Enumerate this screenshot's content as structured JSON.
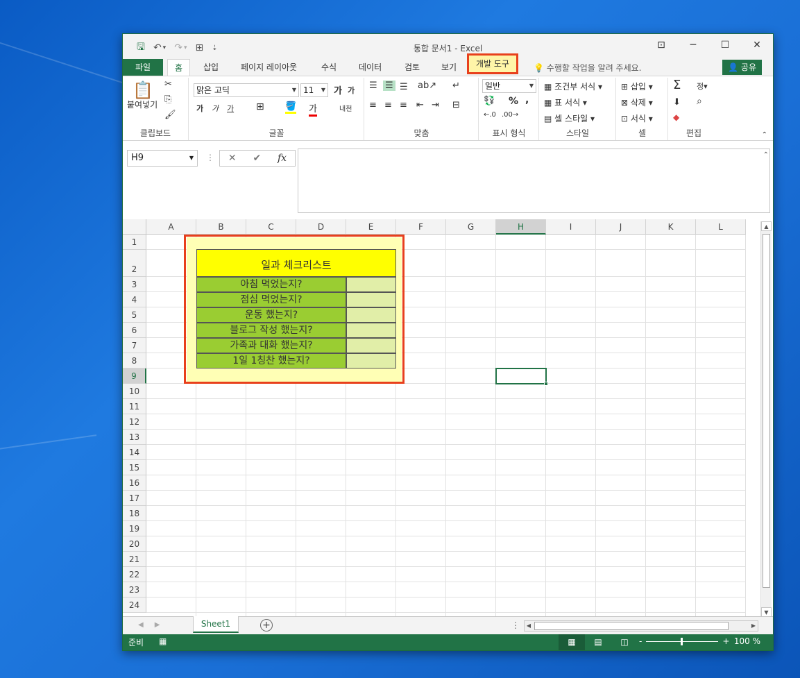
{
  "window": {
    "title": "통합 문서1 - Excel",
    "controls": {
      "ribbon_display": "⊡",
      "minimize": "─",
      "maximize": "☐",
      "close": "✕"
    }
  },
  "qat": {
    "save": "🖫",
    "undo": "↶",
    "undo_drop": "▾",
    "redo": "↷",
    "redo_drop": "▾",
    "touch": "⊞",
    "customize": "⇣"
  },
  "tabs": {
    "file": "파일",
    "home": "홈",
    "insert": "삽입",
    "page_layout": "페이지 레이아웃",
    "formulas": "수식",
    "data": "데이터",
    "review": "검토",
    "view": "보기",
    "developer": "개발 도구",
    "tell_me": "수행할 작업을 알려 주세요.",
    "share": "공유"
  },
  "ribbon": {
    "clipboard": {
      "label": "클립보드",
      "paste": "붙여넣기",
      "cut": "✂",
      "copy": "⎘",
      "format_painter": "🖌"
    },
    "font": {
      "label": "글꼴",
      "font_name": "맑은 고딕",
      "font_size": "11",
      "grow": "가",
      "shrink": "가",
      "bold": "가",
      "italic": "가",
      "underline": "가",
      "border": "⊞",
      "fill": "🪣",
      "font_color": "가",
      "phonetic": "내천"
    },
    "alignment": {
      "label": "맞춤"
    },
    "number": {
      "label": "표시 형식",
      "format": "일반",
      "percent": "%",
      "comma": ","
    },
    "styles": {
      "label": "스타일",
      "conditional": "조건부 서식",
      "table": "표 서식",
      "cell_styles": "셀 스타일"
    },
    "cells": {
      "label": "셀",
      "insert": "삽입",
      "delete": "삭제",
      "format": "서식"
    },
    "editing": {
      "label": "편집",
      "sum": "Σ",
      "sort": "정▾",
      "find": "⌕",
      "fill": "⬇",
      "clear": "◆"
    }
  },
  "formula_bar": {
    "name_box": "H9",
    "cancel": "✕",
    "enter": "✔",
    "fx": "fx",
    "content": ""
  },
  "columns": [
    "A",
    "B",
    "C",
    "D",
    "E",
    "F",
    "G",
    "H",
    "I",
    "J",
    "K",
    "L"
  ],
  "rows": [
    "1",
    "2",
    "3",
    "4",
    "5",
    "6",
    "7",
    "8",
    "9",
    "10",
    "11",
    "12",
    "13",
    "14",
    "15",
    "16",
    "17",
    "18",
    "19",
    "20",
    "21",
    "22",
    "23",
    "24"
  ],
  "selected_cell": "H9",
  "checklist": {
    "title": "일과 체크리스트",
    "items": [
      "아침 먹었는지?",
      "점심 먹었는지?",
      "운동 했는지?",
      "블로그 작성 했는지?",
      "가족과 대화 했는지?",
      "1일 1칭찬 했는지?"
    ],
    "colors": {
      "title_fill": "#ffff00",
      "item_fill": "#9acd32",
      "check_fill": "#e1eea8",
      "highlight": "#ffffb5",
      "annotation": "#e8401c"
    }
  },
  "sheet_tabs": {
    "active": "Sheet1",
    "add": "+"
  },
  "status_bar": {
    "ready": "준비",
    "macro": "▦",
    "zoom": "100 %",
    "zoom_minus": "-",
    "zoom_plus": "+"
  },
  "accent_color": "#217346"
}
